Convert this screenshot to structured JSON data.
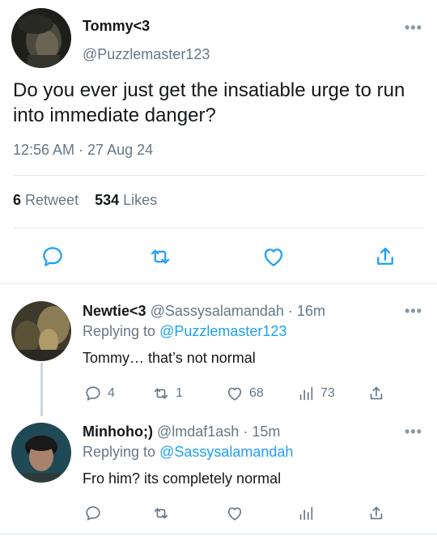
{
  "tweet": {
    "display_name": "Tommy<3",
    "handle": "@Puzzlemaster123",
    "text": "Do you ever just get the insatiable urge to run into immediate danger?",
    "timestamp": "12:56 AM · 27 Aug 24",
    "retweet_count": "6",
    "retweet_label": "Retweet",
    "like_count": "534",
    "like_label": "Likes"
  },
  "replies": [
    {
      "display_name": "Newtie<3",
      "handle": "@Sassysalamandah",
      "time": "· 16m",
      "replying_prefix": "Replying to",
      "replying_to": "@Puzzlemaster123",
      "text": "Tommy… that’s not normal",
      "reply_count": "4",
      "retweet_count": "1",
      "like_count": "68",
      "view_count": "73"
    },
    {
      "display_name": "Minhoho;)",
      "handle": "@lmdaf1ash",
      "time": "· 15m",
      "replying_prefix": "Replying to",
      "replying_to": "@Sassysalamandah",
      "text": "Fro him? its completely normal"
    }
  ],
  "more_glyph": "•••",
  "colors": {
    "link": "#1da1f2",
    "muted": "#657786",
    "divider": "#e1e8ed"
  }
}
